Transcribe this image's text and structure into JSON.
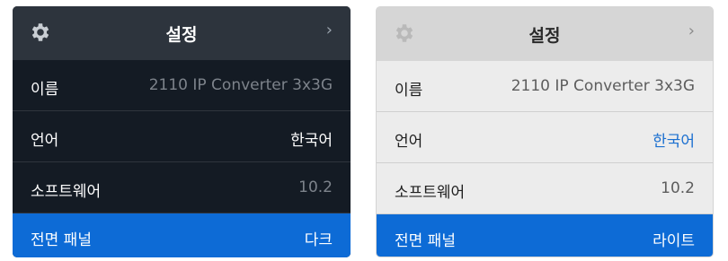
{
  "panels": {
    "dark": {
      "title": "설정",
      "chevron": "›",
      "rows": [
        {
          "label": "이름",
          "value": "2110 IP Converter 3x3G"
        },
        {
          "label": "언어",
          "value": "한국어"
        },
        {
          "label": "소프트웨어",
          "value": "10.2"
        },
        {
          "label": "전면 패널",
          "value": "다크"
        }
      ]
    },
    "light": {
      "title": "설정",
      "chevron": "›",
      "rows": [
        {
          "label": "이름",
          "value": "2110 IP Converter 3x3G"
        },
        {
          "label": "언어",
          "value": "한국어"
        },
        {
          "label": "소프트웨어",
          "value": "10.2"
        },
        {
          "label": "전면 패널",
          "value": "라이트"
        }
      ]
    }
  },
  "icons": {
    "settings": "gear-icon",
    "next": "chevron-right-icon"
  },
  "colors": {
    "accent": "#0d6bd6",
    "dark_bg": "#141b24",
    "light_bg": "#ececec",
    "link": "#1a6fd0"
  }
}
